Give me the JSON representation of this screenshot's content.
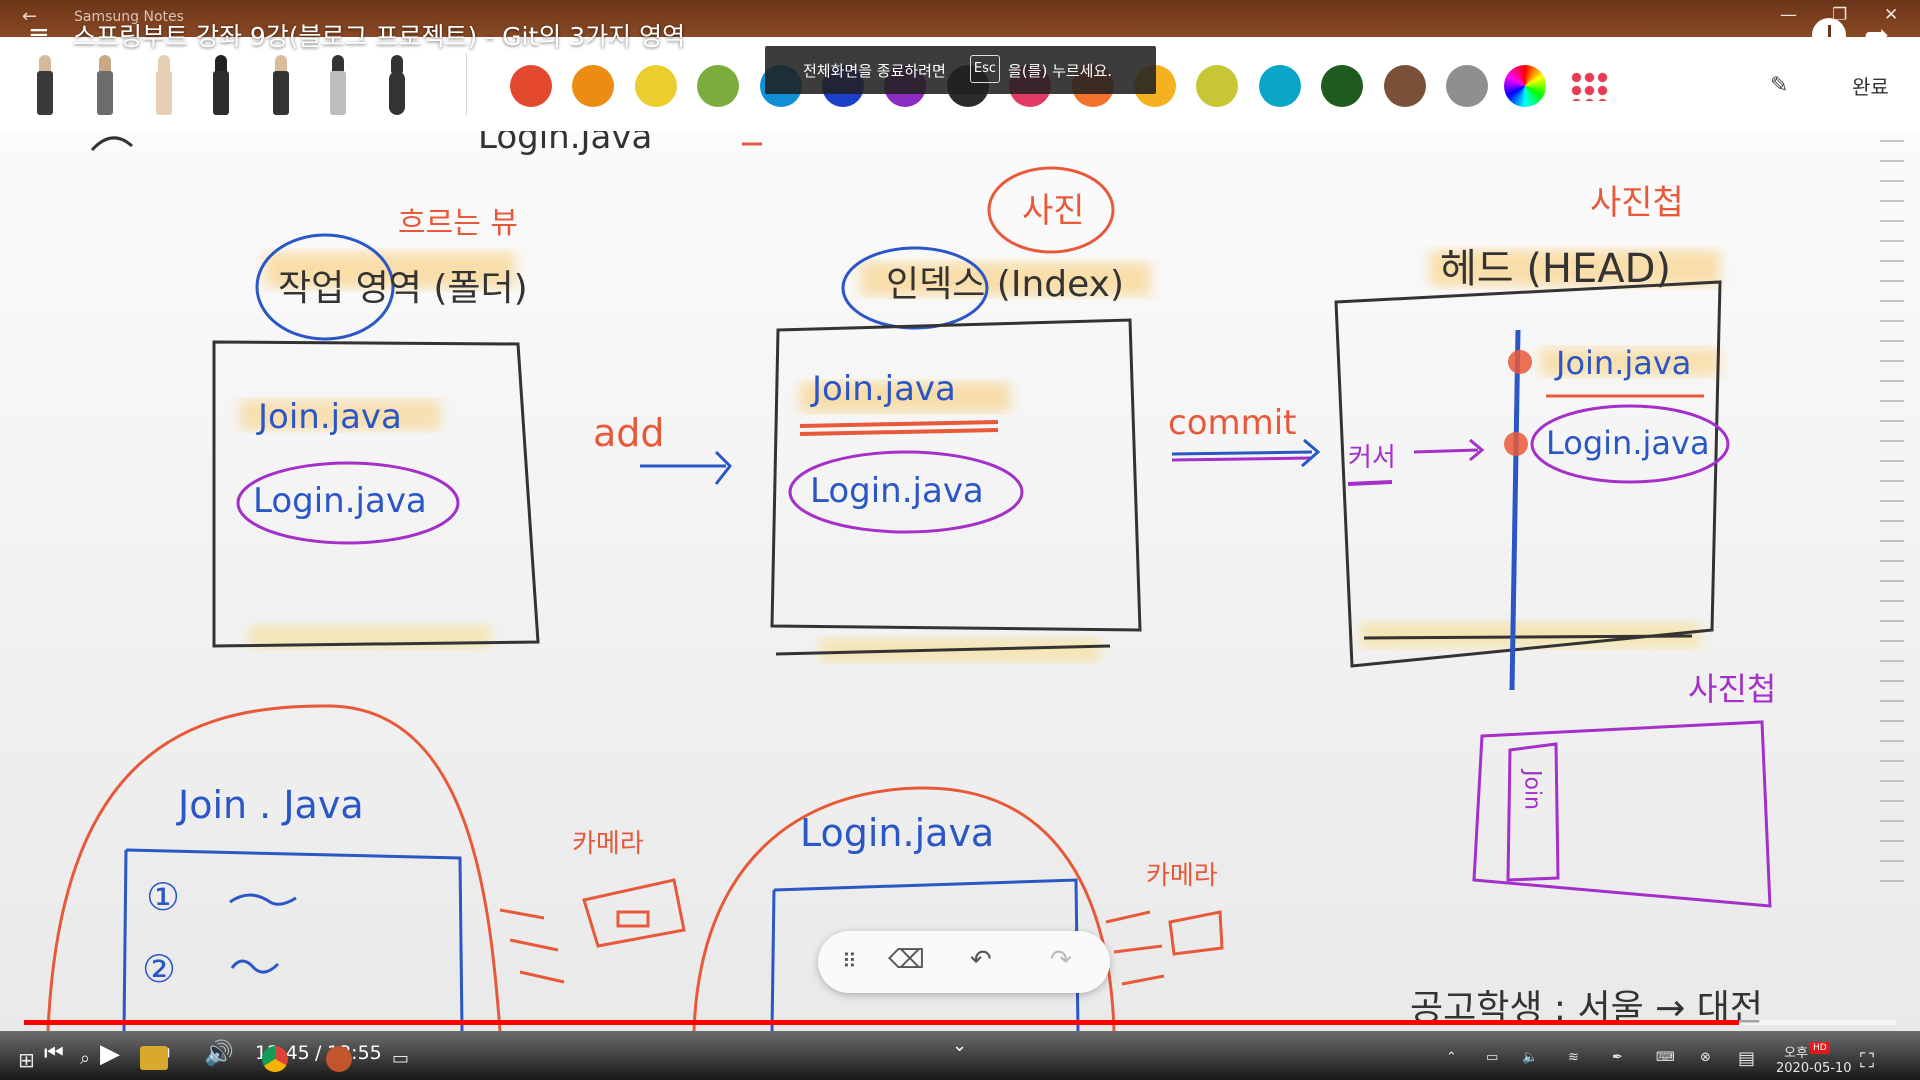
{
  "os_window": {
    "app_name": "Samsung Notes",
    "min": "—",
    "max": "❐",
    "close": "✕"
  },
  "video": {
    "title": "스프링부트 강좌 9강(블로그 프로젝트) - Git의 3가지 영역",
    "current_time": "12:45",
    "separator": "/",
    "duration": "13:55",
    "progress": 0.916
  },
  "fullscreen_toast": {
    "before": "전체화면을 종료하려면",
    "key": "Esc",
    "after": "을(를) 누르세요."
  },
  "toolbar": {
    "done_label": "완료",
    "colors": [
      "#e2492f",
      "#ec8c13",
      "#eccd2f",
      "#7bad3c",
      "#0f8fd6",
      "#1b3fc8",
      "#8c2bbf",
      "#2b2b2b",
      "#e23a63",
      "#f2742c",
      "#f5b220",
      "#c7c735",
      "#0aa6c7",
      "#1f5a1f",
      "#7a5038",
      "#8f8f8f"
    ]
  },
  "notes": {
    "top_partial": "Login.Java",
    "working_label_note": "흐르는 뷰",
    "working_title": "작업 영역 (폴더)",
    "index_note": "사진",
    "index_title": "인덱스 (Index)",
    "head_note": "사진첩",
    "head_title": "헤드 (HEAD)",
    "file_join": "Join.java",
    "file_login": "Login.java",
    "arrow_add": "add",
    "arrow_commit": "commit",
    "key_label": "커서",
    "snapshot_label": "사진첩",
    "vertical_join": "Join",
    "bottom_join": "Join . Java",
    "bottom_login": "Login.java",
    "camera1": "카메라",
    "camera2": "카메라",
    "item1": "①",
    "item2": "②",
    "bottom_right": "공고학생 : 서울 → 대전"
  },
  "taskbar": {
    "time_line1": "오후",
    "time_line2": "2020-05-10",
    "hd_badge": "HD",
    "chevron": "⌃"
  }
}
